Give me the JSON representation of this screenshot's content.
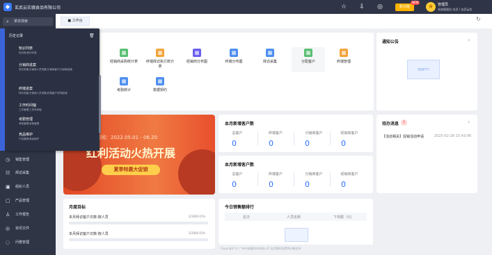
{
  "topbar": {
    "company": "玄武云实赣食品有限公司",
    "new_label": "新功能",
    "new_badge": "NEW",
    "user_name": "管理员",
    "user_role": "系统管理员-玄武 / 玄武云实"
  },
  "sidebar": {
    "search": "菜单搜索",
    "items": [
      {
        "label": "销售管理"
      },
      {
        "label": "拜访采集"
      },
      {
        "label": "组织人员"
      },
      {
        "label": "产品管理"
      },
      {
        "label": "工作报告"
      },
      {
        "label": "资讯文件"
      },
      {
        "label": "问卷管理"
      }
    ]
  },
  "history": {
    "title": "历史记录",
    "items": [
      {
        "title": "知识列表",
        "sub": "知识库/知识列表"
      },
      {
        "title": "分销商进案",
        "sub": "拜访采集/分销商人员采集/分销商客户/分销商进案"
      },
      {
        "title": "终端进案",
        "sub": "拜访采集/分销商人员采集/终端客户/终端进案"
      },
      {
        "title": "工作时间轴",
        "sub": "工作管理/工作时间轴"
      },
      {
        "title": "考勤管理",
        "sub": "考勤管理/考勤管理"
      },
      {
        "title": "竞品维护",
        "sub": "产品管理/竞品维护"
      }
    ]
  },
  "tabs": {
    "workbench": "工作台"
  },
  "shortcuts": [
    {
      "label": "经销商采购统计表"
    },
    {
      "label": "终端拜访执行统计表"
    },
    {
      "label": "经销商分布图"
    },
    {
      "label": "终端分布图"
    },
    {
      "label": "拜访采集"
    },
    {
      "label": "分配客户"
    },
    {
      "label": "终端管理"
    },
    {
      "label": "考勤统计"
    },
    {
      "label": "数据契约"
    }
  ],
  "notice": {
    "title": "通知公告",
    "empty": "EMPTY"
  },
  "monthly_new": {
    "title": "本月新增客户数",
    "labels": [
      "总客户",
      "终端客户",
      "分销商客户",
      "经销商客户"
    ],
    "values": [
      "0",
      "0",
      "0",
      "0"
    ]
  },
  "today_new": {
    "title": "本月新增客户数",
    "labels": [
      "总客户",
      "终端客户",
      "分销商客户",
      "经销商客户"
    ],
    "values": [
      "0",
      "0",
      "0",
      "0"
    ]
  },
  "pending": {
    "title": "待办消息",
    "count": "1",
    "item": "【活动相关】促销活动申请",
    "time": "2025-02-28 15:43:06"
  },
  "banner": {
    "subtitle": "活动时间：2022.05.01 - 06.20",
    "headline": "红利活动火热开展",
    "button": "夏季特惠大促销"
  },
  "monthly_goal": {
    "title": "月度目标",
    "rows": [
      {
        "label": "本月拜访客户次数-按人员",
        "value": "2/3000.01%"
      },
      {
        "label": "本月拜访客户次数-按人员",
        "value": "2/3000.01%"
      }
    ]
  },
  "ranking": {
    "title": "今日销售额排行",
    "cols": [
      "名次",
      "人员名称",
      "下单额（元）"
    ]
  },
  "footer": "Copyright © 广州市玄赣科技有限公司 玄武赣科技提供计算支持",
  "colors": {
    "accent": "#2b6fff",
    "sidebar": "#303546",
    "topbar": "#2f3447",
    "new": "#ffb300"
  }
}
